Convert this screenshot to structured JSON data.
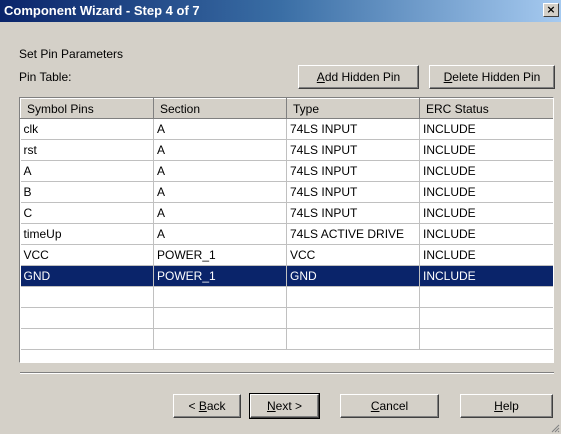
{
  "window": {
    "title": "Component Wizard - Step 4 of 7",
    "close_glyph": "×"
  },
  "labels": {
    "section_title": "Set Pin Parameters",
    "pin_table": "Pin Table:"
  },
  "buttons": {
    "add_hidden_pin": {
      "mnemonic": "A",
      "rest": "dd Hidden Pin"
    },
    "delete_hidden_pin": {
      "mnemonic": "D",
      "rest": "elete Hidden Pin"
    },
    "back": {
      "prefix": "< ",
      "mnemonic": "B",
      "rest": "ack"
    },
    "next": {
      "mnemonic": "N",
      "rest": "ext >"
    },
    "cancel": {
      "mnemonic": "C",
      "rest": "ancel"
    },
    "help": {
      "mnemonic": "H",
      "rest": "elp"
    }
  },
  "table": {
    "columns": [
      "Symbol Pins",
      "Section",
      "Type",
      "ERC Status"
    ],
    "rows": [
      [
        "clk",
        "A",
        "74LS INPUT",
        "INCLUDE"
      ],
      [
        "rst",
        "A",
        "74LS INPUT",
        "INCLUDE"
      ],
      [
        "A",
        "A",
        "74LS INPUT",
        "INCLUDE"
      ],
      [
        "B",
        "A",
        "74LS INPUT",
        "INCLUDE"
      ],
      [
        "C",
        "A",
        "74LS INPUT",
        "INCLUDE"
      ],
      [
        "timeUp",
        "A",
        "74LS ACTIVE DRIVE",
        "INCLUDE"
      ],
      [
        "VCC",
        "POWER_1",
        "VCC",
        "INCLUDE"
      ],
      [
        "GND",
        "POWER_1",
        "GND",
        "INCLUDE"
      ],
      [
        "",
        "",
        "",
        ""
      ],
      [
        "",
        "",
        "",
        ""
      ],
      [
        "",
        "",
        "",
        ""
      ]
    ],
    "selected_row": 7
  },
  "colors": {
    "dialog_bg": "#d4d0c8",
    "titlebar_start": "#0a246a",
    "titlebar_end": "#a6caf0",
    "selection": "#0a246a"
  }
}
